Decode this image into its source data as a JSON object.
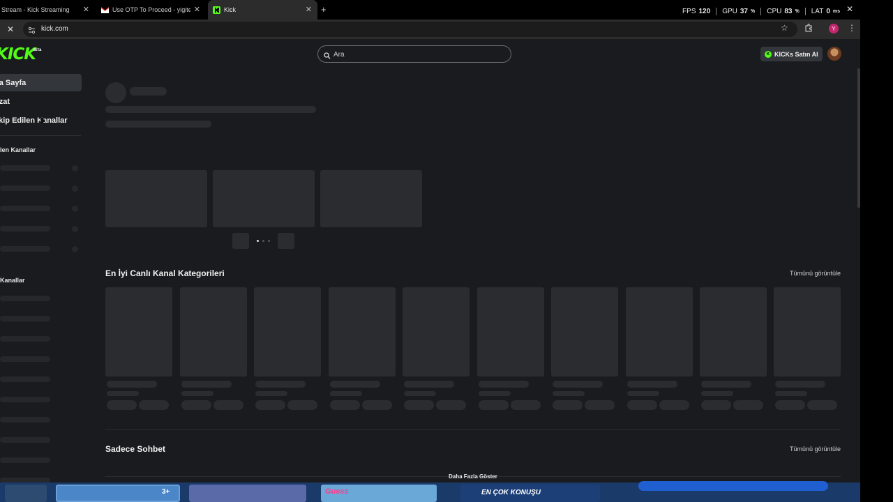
{
  "browser": {
    "tabs": [
      {
        "title": "Stream - Kick Streaming",
        "close": "✕",
        "icon": "kick-favicon"
      },
      {
        "title": "Use OTP To Proceed - yigitegel",
        "close": "✕",
        "icon": "gmail-favicon"
      },
      {
        "title": "Kick",
        "close": "✕",
        "icon": "kick-favicon",
        "active": true
      }
    ],
    "new_tab": "+",
    "url": "kick.com",
    "stop": "✕",
    "star": "☆",
    "menu": "⋮",
    "profile_initial": "Y",
    "window_close": "✕"
  },
  "stats": {
    "fps_label": "FPS",
    "fps_value": "120",
    "gpu_label": "GPU",
    "gpu_value": "37",
    "gpu_unit": "%",
    "cpu_label": "CPU",
    "cpu_value": "83",
    "cpu_unit": "%",
    "lat_label": "LAT",
    "lat_value": "0",
    "lat_unit": "ms"
  },
  "header": {
    "logo": "KICK",
    "logo_badge": "BETA",
    "search_placeholder": "Ara",
    "kicks_button": "KICKs Satın Al"
  },
  "sidebar": {
    "items": [
      {
        "label": "Ana Sayfa",
        "visible": "na Sayfa",
        "active": true
      },
      {
        "label": "Gözat",
        "visible": "özat"
      },
      {
        "label": "Takip Edilen Kanallar",
        "visible": "akip Edilen Kanallar"
      }
    ],
    "sections": [
      {
        "label": "Önerilen Kanallar",
        "visible": "dilen Kanallar"
      },
      {
        "label": "Popüler Kanallar",
        "visible": "n Kanallar"
      }
    ]
  },
  "main": {
    "categories_title": "En İyi Canlı Kanal Kategorileri",
    "see_all_1": "Tümünü görüntüle",
    "chat_title": "Sadece Sohbet",
    "see_all_2": "Tümünü görüntüle",
    "show_more": "Daha Fazla Göster"
  },
  "banner": {
    "count_badge": "3+",
    "game_label": "Guess",
    "promo_label": "EN ÇOK KONUŞU"
  },
  "colors": {
    "accent": "#53fc18",
    "background": "#191b1f",
    "skeleton": "#2a2c30",
    "profile": "#c4266d"
  }
}
